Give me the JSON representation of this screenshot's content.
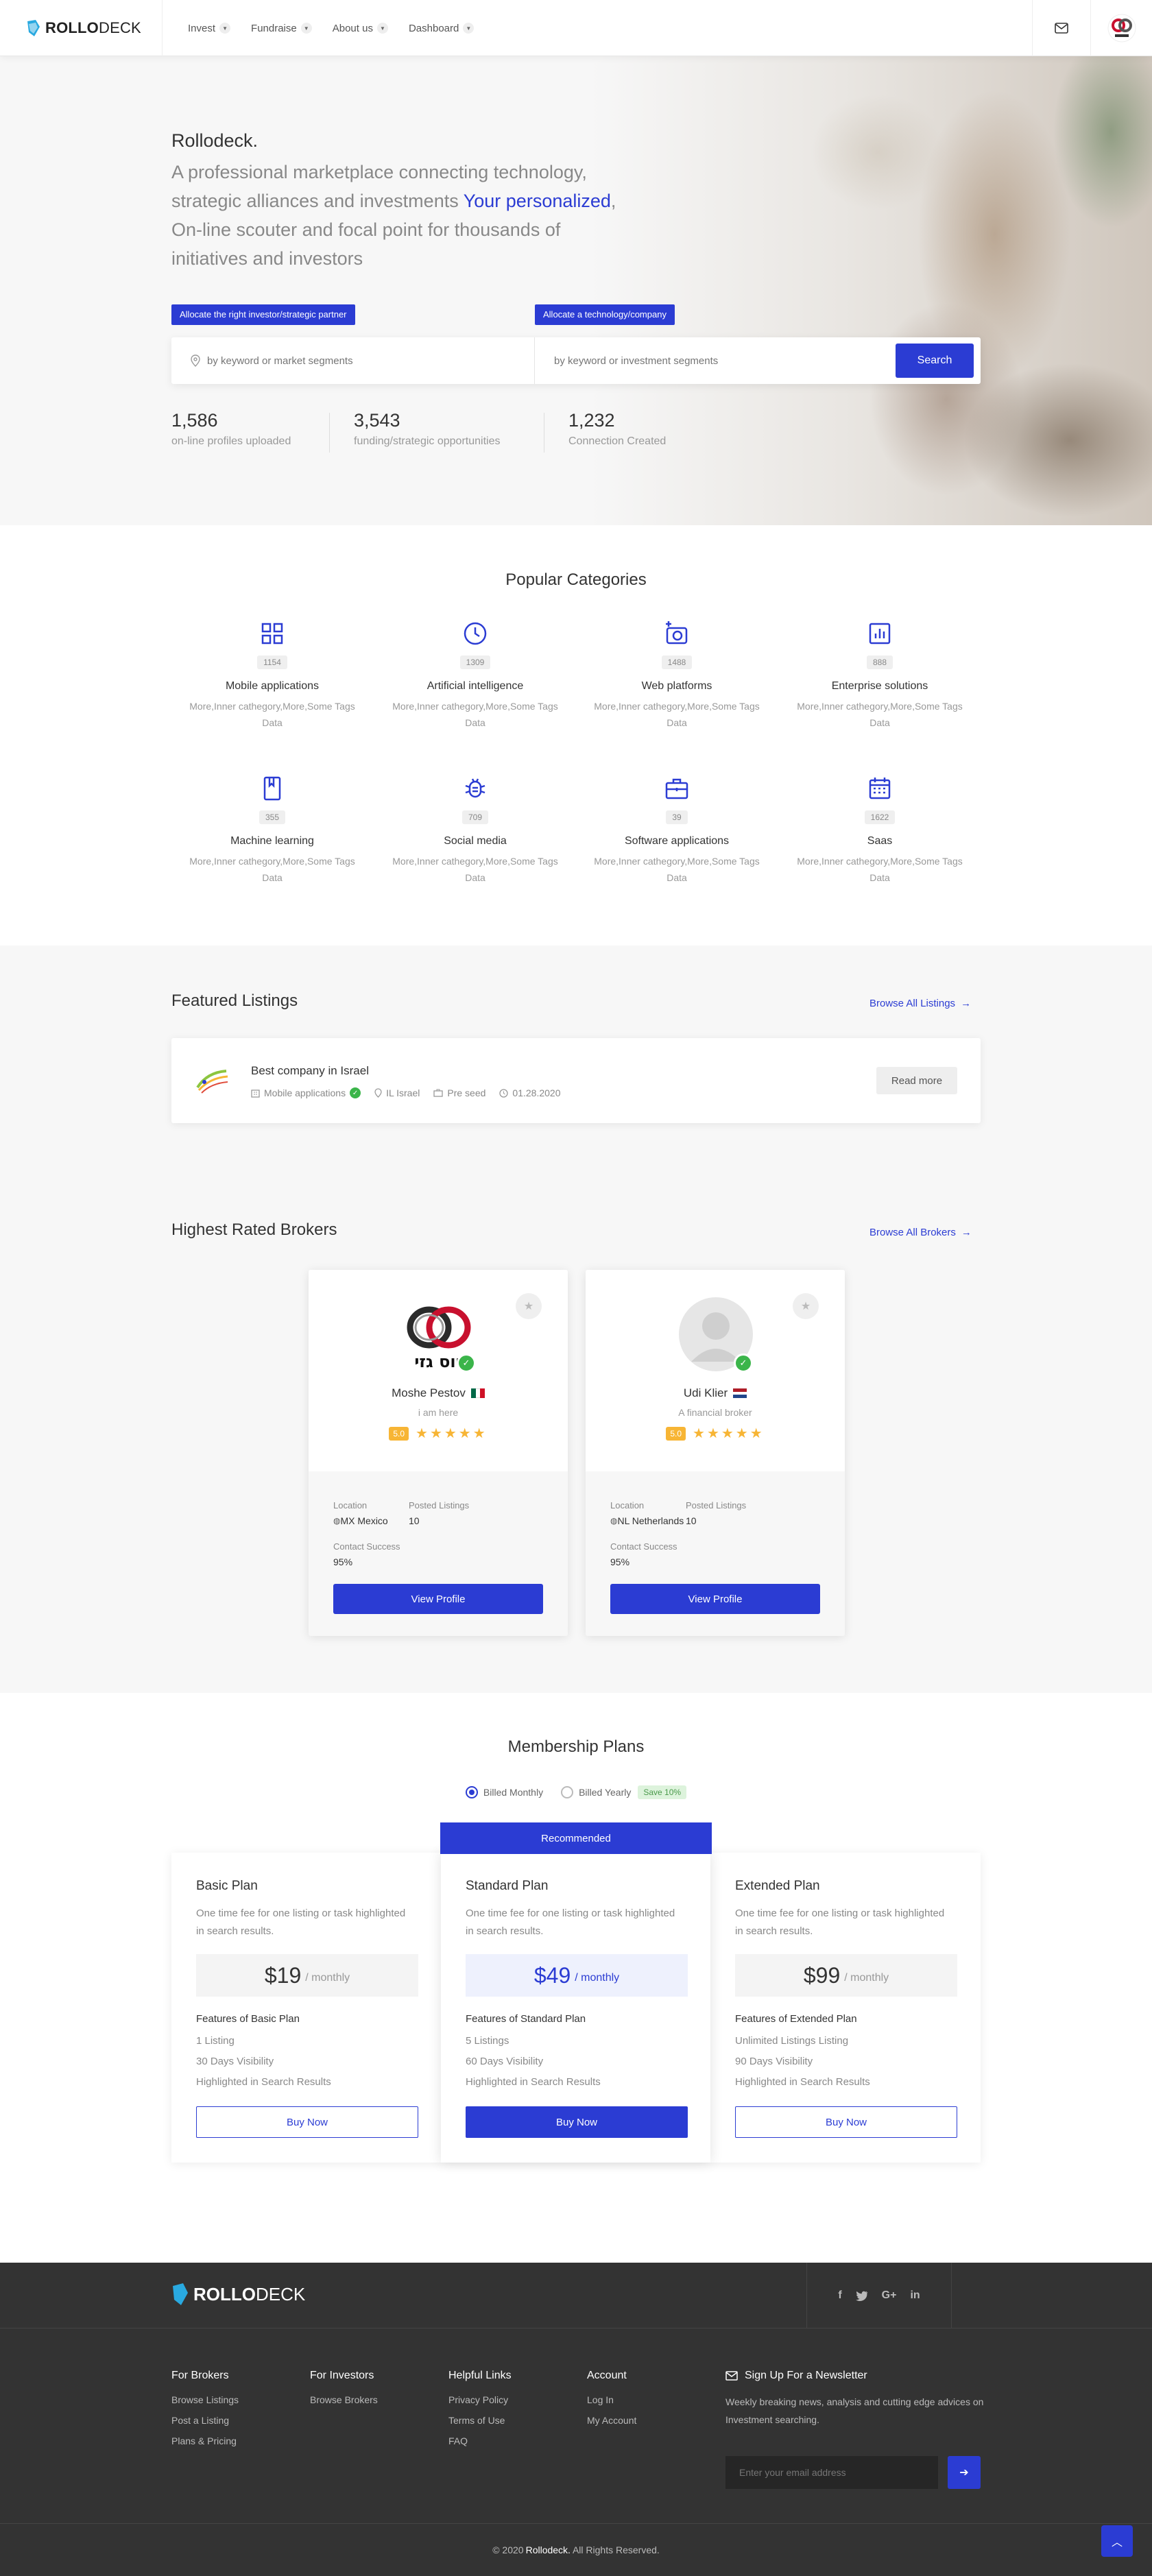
{
  "header": {
    "logo_text_bold": "ROLLO",
    "logo_text_light": "DECK",
    "nav": [
      {
        "label": "Invest"
      },
      {
        "label": "Fundraise"
      },
      {
        "label": "About us"
      },
      {
        "label": "Dashboard"
      }
    ],
    "icons": {
      "mail": "mail-icon",
      "avatar": "user-avatar"
    }
  },
  "hero": {
    "brand": "Rollodeck.",
    "line_part1": "A professional marketplace connecting technology, strategic alliances and investments ",
    "highlight": "Your personalized",
    "line_part2": ", On-line scouter and focal point for thousands of initiatives and investors",
    "tag_left": "Allocate the right investor/strategic partner",
    "tag_right": "Allocate a technology/company",
    "search_left_placeholder": "by keyword or market segments",
    "search_right_placeholder": "by keyword or investment segments",
    "search_button": "Search",
    "stats": [
      {
        "value": "1,586",
        "label": "on-line profiles uploaded"
      },
      {
        "value": "3,543",
        "label": "funding/strategic opportunities"
      },
      {
        "value": "1,232",
        "label": "Connection Created"
      }
    ]
  },
  "categories": {
    "title": "Popular Categories",
    "items": [
      {
        "icon": "grid-icon",
        "count": "1154",
        "name": "Mobile applications",
        "sub": "More,Inner cathegory,More,Some Tags Data"
      },
      {
        "icon": "clock-icon",
        "count": "1309",
        "name": "Artificial intelligence",
        "sub": "More,Inner cathegory,More,Some Tags Data"
      },
      {
        "icon": "camera-plus-icon",
        "count": "1488",
        "name": "Web platforms",
        "sub": "More,Inner cathegory,More,Some Tags Data"
      },
      {
        "icon": "bar-chart-icon",
        "count": "888",
        "name": "Enterprise solutions",
        "sub": "More,Inner cathegory,More,Some Tags Data"
      },
      {
        "icon": "book-icon",
        "count": "355",
        "name": "Machine learning",
        "sub": "More,Inner cathegory,More,Some Tags Data"
      },
      {
        "icon": "bug-icon",
        "count": "709",
        "name": "Social media",
        "sub": "More,Inner cathegory,More,Some Tags Data"
      },
      {
        "icon": "briefcase-icon",
        "count": "39",
        "name": "Software applications",
        "sub": "More,Inner cathegory,More,Some Tags Data"
      },
      {
        "icon": "calendar-icon",
        "count": "1622",
        "name": "Saas",
        "sub": "More,Inner cathegory,More,Some Tags Data"
      }
    ]
  },
  "featured": {
    "title": "Featured Listings",
    "browse": "Browse All Listings",
    "listing": {
      "title": "Best company in Israel",
      "category": "Mobile applications",
      "location": "IL Israel",
      "stage": "Pre seed",
      "date": "01.28.2020",
      "button": "Read more"
    }
  },
  "brokers": {
    "title": "Highest Rated Brokers",
    "browse": "Browse All Brokers",
    "location_label": "Location",
    "posted_label": "Posted Listings",
    "success_label": "Contact Success",
    "button": "View Profile",
    "items": [
      {
        "name": "Moshe Pestov",
        "role": "i am here",
        "rating": "5.0",
        "stars": 5,
        "location": "MX Mexico",
        "posted": "10",
        "success": "95%",
        "logo_text": "יוס גזי"
      },
      {
        "name": "Udi Klier",
        "role": "A financial broker",
        "rating": "5.0",
        "stars": 5,
        "location": "NL Netherlands",
        "posted": "10",
        "success": "95%"
      }
    ]
  },
  "plans": {
    "title": "Membership Plans",
    "billed_monthly": "Billed Monthly",
    "billed_yearly": "Billed Yearly",
    "save": "Save 10%",
    "recommended": "Recommended",
    "per": "/ monthly",
    "button": "Buy Now",
    "items": [
      {
        "name": "Basic Plan",
        "desc": "One time fee for one listing or task highlighted in search results.",
        "price": "$19",
        "features_title": "Features of Basic Plan",
        "features": [
          "1 Listing",
          "30 Days Visibility",
          "Highlighted in Search Results"
        ]
      },
      {
        "name": "Standard Plan",
        "desc": "One time fee for one listing or task highlighted in search results.",
        "price": "$49",
        "features_title": "Features of Standard Plan",
        "features": [
          "5 Listings",
          "60 Days Visibility",
          "Highlighted in Search Results"
        ]
      },
      {
        "name": "Extended Plan",
        "desc": "One time fee for one listing or task highlighted in search results.",
        "price": "$99",
        "features_title": "Features of Extended Plan",
        "features": [
          "Unlimited Listings Listing",
          "90 Days Visibility",
          "Highlighted in Search Results"
        ]
      }
    ]
  },
  "footer": {
    "logo_bold": "ROLLO",
    "logo_light": "DECK",
    "social": [
      "f",
      "t",
      "G+",
      "in"
    ],
    "cols": [
      {
        "title": "For Brokers",
        "links": [
          "Browse Listings",
          "Post a Listing",
          "Plans & Pricing"
        ]
      },
      {
        "title": "For Investors",
        "links": [
          "Browse Brokers"
        ]
      },
      {
        "title": "Helpful Links",
        "links": [
          "Privacy Policy",
          "Terms of Use",
          "FAQ"
        ]
      },
      {
        "title": "Account",
        "links": [
          "Log In",
          "My Account"
        ]
      }
    ],
    "newsletter_title": "Sign Up For a Newsletter",
    "newsletter_text": "Weekly breaking news, analysis and cutting edge advices on Investment searching.",
    "newsletter_placeholder": "Enter your email address",
    "copy_pre": "© 2020",
    "copy_brand": "Rollodeck.",
    "copy_post": "All Rights Reserved."
  },
  "colors": {
    "accent": "#2b3cd3",
    "star": "#f7b535",
    "verified": "#3bb54a",
    "footer_bg": "#333333"
  }
}
